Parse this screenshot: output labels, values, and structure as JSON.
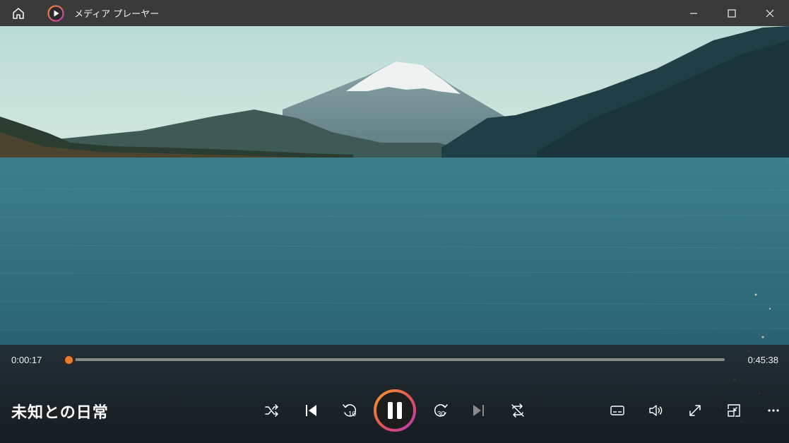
{
  "window": {
    "title": "メディア プレーヤー",
    "home_icon": "home-icon",
    "app_icon": "media-player-app-icon",
    "minimize_icon": "minimize-icon",
    "maximize_icon": "maximize-icon",
    "close_icon": "close-icon"
  },
  "player": {
    "current_time": "0:00:17",
    "duration": "0:45:38",
    "progress": 0.006,
    "track_title": "未知との日常",
    "accent_color": "#f07a2c"
  },
  "buttons": {
    "shuffle": {
      "icon": "shuffle-icon"
    },
    "previous": {
      "icon": "skip-previous-icon"
    },
    "rewind": {
      "icon": "rewind-10-icon",
      "label": "10"
    },
    "play_pause": {
      "icon": "pause-icon"
    },
    "forward": {
      "icon": "forward-30-icon",
      "label": "30"
    },
    "next": {
      "icon": "skip-next-icon"
    },
    "repeat": {
      "icon": "repeat-off-icon"
    },
    "subtitles": {
      "icon": "subtitles-icon"
    },
    "volume": {
      "icon": "volume-icon"
    },
    "fullscreen": {
      "icon": "fullscreen-icon"
    },
    "mini_view": {
      "icon": "mini-view-icon"
    },
    "more": {
      "icon": "more-icon"
    }
  }
}
